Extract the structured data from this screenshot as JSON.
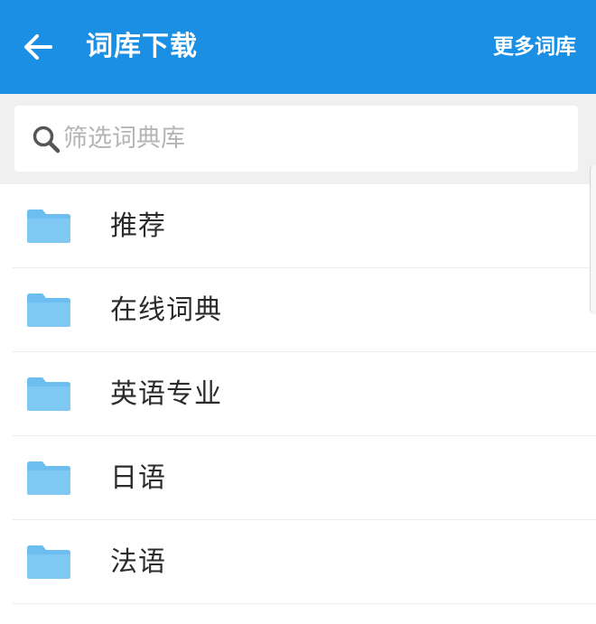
{
  "header": {
    "title": "词库下载",
    "more_label": "更多词库"
  },
  "search": {
    "placeholder": "筛选词典库",
    "value": ""
  },
  "list": {
    "items": [
      {
        "label": "推荐"
      },
      {
        "label": "在线词典"
      },
      {
        "label": "英语专业"
      },
      {
        "label": "日语"
      },
      {
        "label": "法语"
      }
    ]
  },
  "icons": {
    "back": "arrow-left-icon",
    "search": "search-icon",
    "folder": "folder-icon"
  },
  "colors": {
    "header_bg": "#1a8fe3",
    "folder": "#6cbef0",
    "text": "#2b2b2b",
    "placeholder": "#b5b5b5"
  }
}
